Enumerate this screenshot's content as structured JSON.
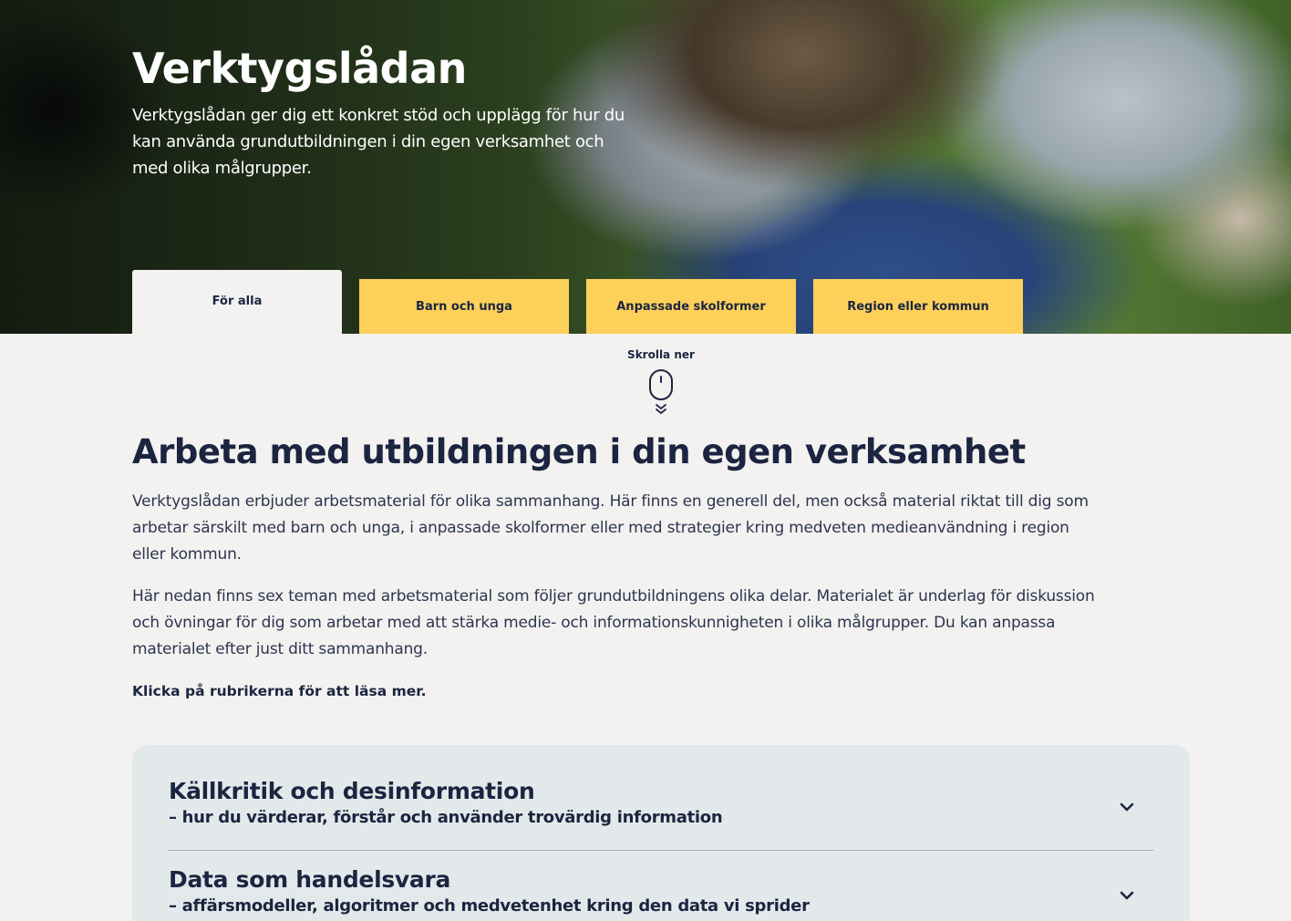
{
  "hero": {
    "title": "Verktygslådan",
    "description": "Verktygslådan ger dig ett konkret stöd och upplägg för hur du kan använda grundutbildningen i din egen verksamhet och med olika målgrupper."
  },
  "tabs": [
    {
      "label": "För alla",
      "active": true
    },
    {
      "label": "Barn och unga",
      "active": false
    },
    {
      "label": "Anpassade skolformer",
      "active": false
    },
    {
      "label": "Region eller kommun",
      "active": false
    }
  ],
  "scroll": {
    "label": "Skrolla ner",
    "icon": "mouse-scroll-icon"
  },
  "main": {
    "title": "Arbeta med utbildningen i din egen verksamhet",
    "paragraph1": "Verktygslådan erbjuder arbetsmaterial för olika sammanhang. Här finns en generell del, men också material riktat till dig som arbetar särskilt med barn och unga, i anpassade skolformer eller med strategier kring medveten medieanvändning i region eller kommun.",
    "paragraph2": "Här nedan finns sex teman med arbetsmaterial som följer grundutbildningens olika delar. Materialet är underlag för diskussion och övningar för dig som arbetar med att stärka medie- och informationskunnigheten i olika målgrupper. Du kan anpassa materialet efter just ditt sammanhang.",
    "cta": "Klicka på rubrikerna för att läsa mer."
  },
  "accordion": [
    {
      "title": "Källkritik och desinformation",
      "subtitle": "– hur du värderar, förstår och använder trovärdig information",
      "icon": "chevron-down-icon"
    },
    {
      "title": "Data som handelsvara",
      "subtitle": "– affärsmodeller, algoritmer och medvetenhet kring den data vi sprider",
      "icon": "chevron-down-icon"
    }
  ],
  "colors": {
    "tab_yellow": "#fdd05a",
    "navy": "#1b2541",
    "page_bg": "#f3f2f0",
    "accordion_bg": "#e3e9ea"
  }
}
